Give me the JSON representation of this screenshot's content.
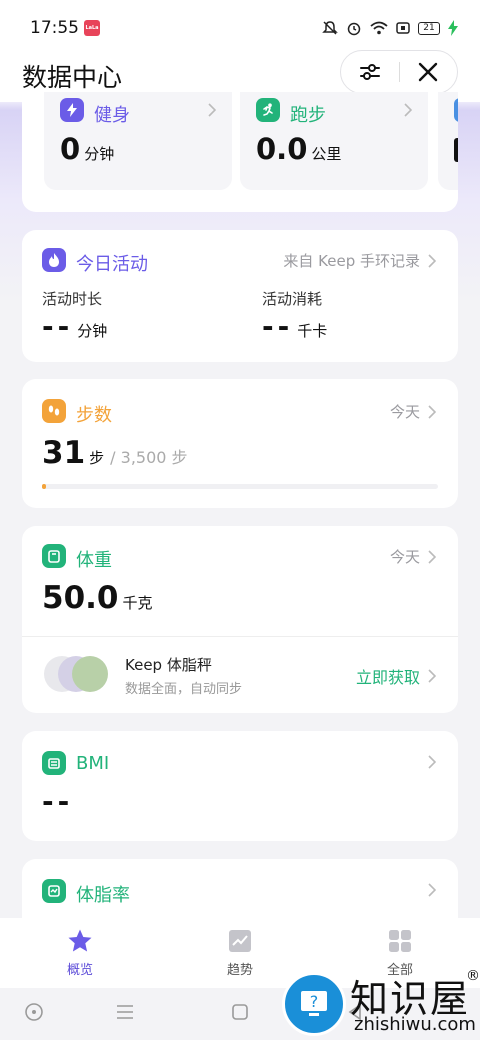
{
  "status": {
    "time": "17:55",
    "battery": "21",
    "app_logo": "LaLa"
  },
  "header": {
    "title": "数据中心"
  },
  "summary": {
    "items": [
      {
        "label": "健身",
        "value": "0",
        "unit": "分钟",
        "color": "#6b5ce7",
        "icon": "bolt-icon"
      },
      {
        "label": "跑步",
        "value": "0.0",
        "unit": "公里",
        "color": "#22b37a",
        "icon": "runner-icon"
      }
    ]
  },
  "activity": {
    "title": "今日活动",
    "source": "来自 Keep 手环记录",
    "duration_label": "活动时长",
    "duration_value": "--",
    "duration_unit": "分钟",
    "calories_label": "活动消耗",
    "calories_value": "--",
    "calories_unit": "千卡",
    "color": "#6b5ce7"
  },
  "steps": {
    "title": "步数",
    "date": "今天",
    "value": "31",
    "unit": "步",
    "goal": "/ 3,500 步",
    "progress": 0.009,
    "color": "#f3a33a"
  },
  "weight": {
    "title": "体重",
    "date": "今天",
    "value": "50.0",
    "unit": "千克",
    "color": "#22b37a",
    "promo_title": "Keep 体脂秤",
    "promo_sub": "数据全面，自动同步",
    "promo_action": "立即获取"
  },
  "bmi": {
    "title": "BMI",
    "value": "--",
    "color": "#22b37a"
  },
  "bodyfat": {
    "title": "体脂率",
    "color": "#22b37a"
  },
  "nav": {
    "items": [
      {
        "label": "概览",
        "active": true
      },
      {
        "label": "趋势",
        "active": false
      },
      {
        "label": "全部",
        "active": false
      }
    ]
  },
  "watermark": {
    "text": "知识屋",
    "sub": "zhishiwu.com",
    "mark": "®"
  }
}
